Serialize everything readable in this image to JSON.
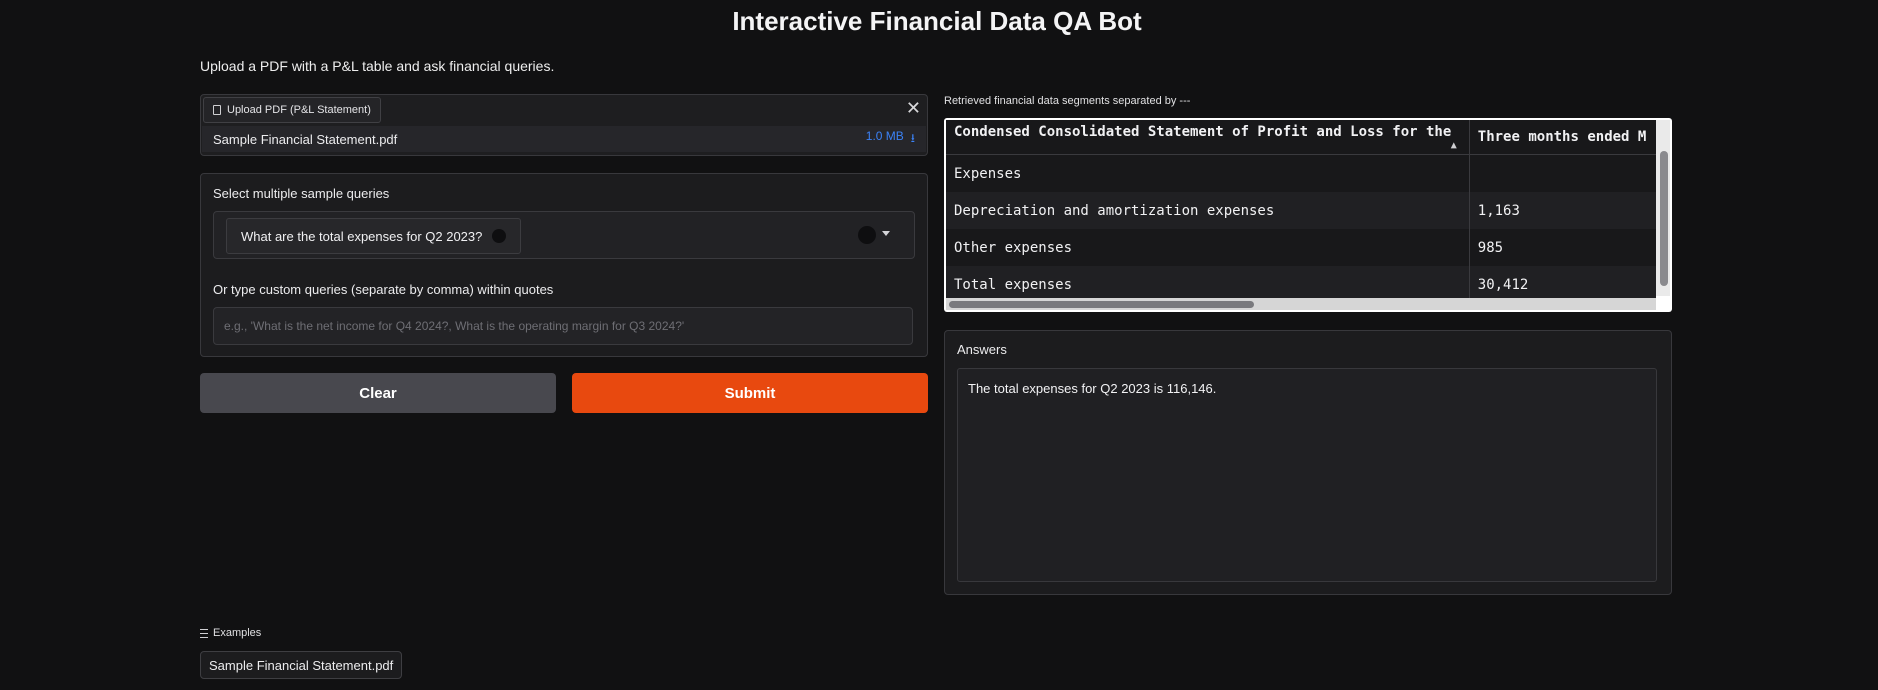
{
  "header": {
    "title": "Interactive Financial Data QA Bot",
    "subtitle": "Upload a PDF with a P&L table and ask financial queries."
  },
  "upload": {
    "label": "Upload PDF (P&L Statement)",
    "file_name": "Sample Financial Statement.pdf",
    "file_size": "1.0 MB",
    "download_glyph": "⭳"
  },
  "queries": {
    "select_label": "Select multiple sample queries",
    "selected_chip": "What are the total expenses for Q2 2023?",
    "custom_label": "Or type custom queries (separate by comma) within quotes",
    "custom_placeholder": "e.g., 'What is the net income for Q4 2024?, What is the operating margin for Q3 2024?'",
    "custom_value": ""
  },
  "buttons": {
    "clear": "Clear",
    "submit": "Submit"
  },
  "segments": {
    "label": "Retrieved financial data segments separated by ---",
    "columns": [
      "Condensed Consolidated Statement of Profit and Loss for the",
      "Three months ended M"
    ],
    "rows": [
      [
        "Expenses",
        ""
      ],
      [
        "Depreciation and amortization expenses",
        "1,163"
      ],
      [
        "Other expenses",
        "985"
      ],
      [
        "Total expenses",
        "30,412"
      ]
    ],
    "sort_glyph": "▲"
  },
  "answers": {
    "label": "Answers",
    "text": "The total expenses for Q2 2023 is 116,146."
  },
  "examples": {
    "label": "Examples",
    "items": [
      "Sample Financial Statement.pdf"
    ]
  },
  "icons": {
    "close": "✕"
  },
  "colors": {
    "accent": "#e8490f",
    "link": "#3b82f6",
    "background": "#111112"
  }
}
